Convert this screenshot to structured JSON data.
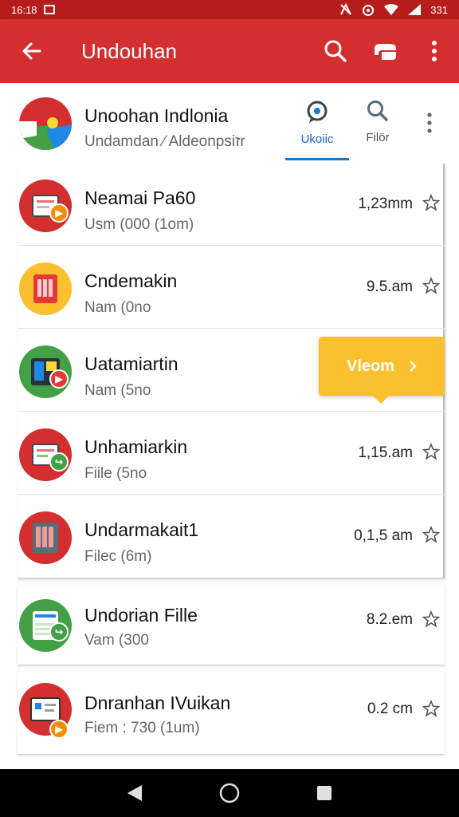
{
  "status_bar": {
    "time": "16:18",
    "battery": "331"
  },
  "app_bar": {
    "title": "Undouhan"
  },
  "header": {
    "title": "Unoohan Indlonia",
    "subtitle": "Undamdan  ⁄  Aldeonpsiזr",
    "tabs": [
      {
        "label": "Ukoiic"
      },
      {
        "label": "Filör"
      }
    ]
  },
  "items": [
    {
      "name": "Neamai Pa60",
      "meta": "Usm (000 (1om)",
      "size": "1,23mm",
      "icon_color": "#d32f2f",
      "badge_color": "#fb8c00"
    },
    {
      "name": "Cndemakin",
      "meta": "Nam (0no",
      "size": "9.5.am",
      "icon_color": "#fbc02d",
      "badge_color": ""
    },
    {
      "name": "Uatamiartin",
      "meta": "Nam (5no",
      "size": "",
      "icon_color": "#43a047",
      "badge_color": "#e53935"
    },
    {
      "name": "Unhamiarkin",
      "meta": "Fiile (5no",
      "size": "1,15.am",
      "icon_color": "#d32f2f",
      "badge_color": "#43a047"
    },
    {
      "name": "Undarmakait1",
      "meta": "Filec (6m)",
      "size": "0,1,5 am",
      "icon_color": "#d32f2f",
      "badge_color": ""
    },
    {
      "name": "Undorian Fille",
      "meta": "Vam (300",
      "size": "8.2.em",
      "icon_color": "#43a047",
      "badge_color": "#43a047"
    },
    {
      "name": "Dnranhan IVuikan",
      "meta": "Fiem : 730 (1um)",
      "size": "0.2 cm",
      "icon_color": "#d32f2f",
      "badge_color": "#fb8c00"
    }
  ],
  "cta": {
    "label": "Vleom"
  }
}
